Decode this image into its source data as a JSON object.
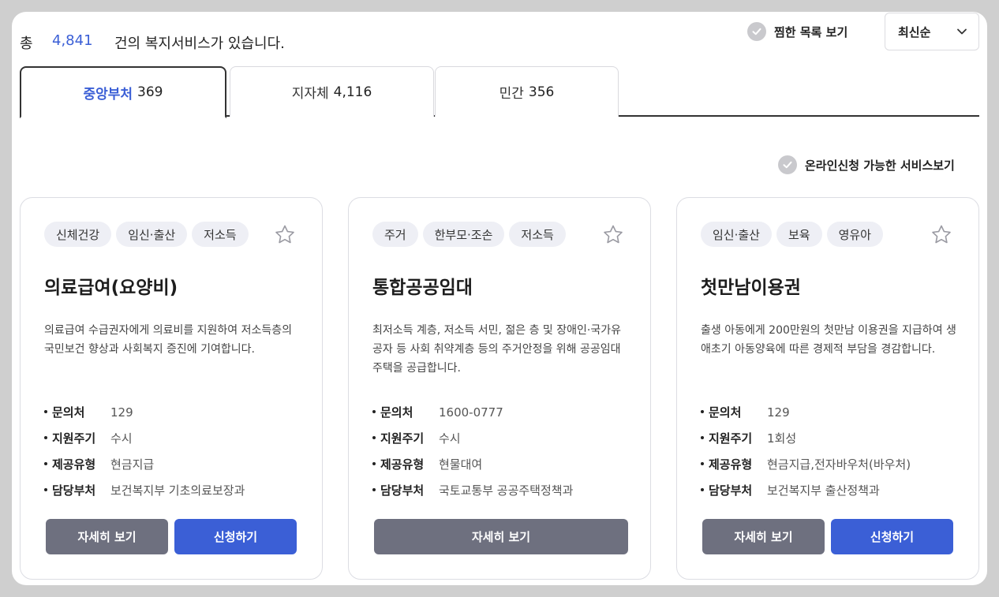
{
  "header": {
    "total_prefix": "총",
    "total_count": "4,841",
    "total_suffix": "건의 복지서비스가 있습니다.",
    "liked_toggle": "찜한 목록 보기",
    "sort_value": "최신순"
  },
  "tabs": [
    {
      "label": "중앙부처",
      "count": "369"
    },
    {
      "label": "지자체",
      "count": "4,116"
    },
    {
      "label": "민간",
      "count": "356"
    }
  ],
  "online_toggle": "온라인신청 가능한 서비스보기",
  "info_labels": {
    "contact": "문의처",
    "cycle": "지원주기",
    "type": "제공유형",
    "dept": "담당부처"
  },
  "cards": [
    {
      "tags": [
        "신체건강",
        "임신·출산",
        "저소득"
      ],
      "title": "의료급여(요양비)",
      "desc": "의료급여 수급권자에게 의료비를 지원하여 저소득층의  국민보건 향상과 사회복지 증진에 기여합니다.",
      "contact": "129",
      "cycle": "수시",
      "type": "현금지급",
      "dept": "보건복지부 기초의료보장과",
      "detail_label": "자세히 보기",
      "apply_label": "신청하기"
    },
    {
      "tags": [
        "주거",
        "한부모·조손",
        "저소득"
      ],
      "title": "통합공공임대",
      "desc": "최저소득 계층, 저소득 서민, 젊은 층 및 장애인·국가유공자 등 사회 취약계층 등의 주거안정을 위해 공공임대주택을 공급합니다.",
      "contact": "1600-0777",
      "cycle": "수시",
      "type": "현물대여",
      "dept": "국토교통부 공공주택정책과",
      "detail_label": "자세히 보기"
    },
    {
      "tags": [
        "임신·출산",
        "보육",
        "영유아"
      ],
      "title": "첫만남이용권",
      "desc": "출생 아동에게 200만원의 첫만남 이용권을 지급하여 생애초기 아동양육에 따른 경제적 부담을 경감합니다.",
      "contact": "129",
      "cycle": "1회성",
      "type": "현금지급,전자바우처(바우처)",
      "dept": "보건복지부 출산정책과",
      "detail_label": "자세히 보기",
      "apply_label": "신청하기"
    }
  ],
  "icons": {
    "check": "check-circle-icon",
    "star": "star-outline-icon",
    "chevron": "chevron-down-icon"
  },
  "colors": {
    "accent": "#3b5fd6",
    "button_gray": "#6e707f",
    "tag_bg": "#eeeff5"
  }
}
